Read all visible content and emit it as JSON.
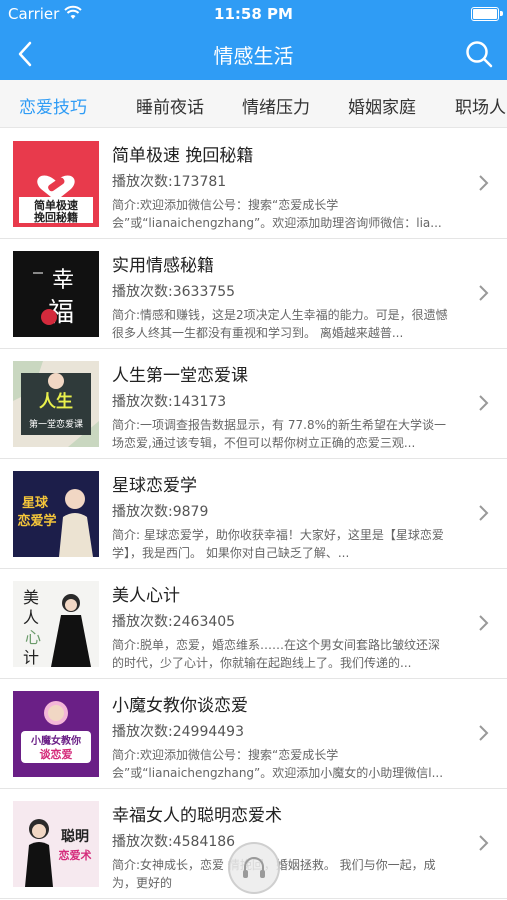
{
  "status_bar": {
    "carrier": "Carrier",
    "time": "11:58 PM"
  },
  "nav": {
    "title": "情感生活"
  },
  "tabs": [
    {
      "label": "恋爱技巧",
      "active": true
    },
    {
      "label": "睡前夜话",
      "active": false
    },
    {
      "label": "情绪压力",
      "active": false
    },
    {
      "label": "婚姻家庭",
      "active": false
    },
    {
      "label": "职场人",
      "active": false
    }
  ],
  "items": [
    {
      "title": "简单极速 挽回秘籍",
      "plays": "播放次数:173781",
      "desc": "简介:欢迎添加微信公号：搜索“恋爱成长学会”或“lianaichengzhang”。欢迎添加助理咨询师微信：lia...",
      "cover_text": "简单极速挽回秘籍"
    },
    {
      "title": "实用情感秘籍",
      "plays": "播放次数:3633755",
      "desc": "简介:情感和赚钱，这是2项决定人生幸福的能力。可是，很遗憾很多人终其一生都没有重视和学习到。 离婚越来越普...",
      "cover_text": "幸福"
    },
    {
      "title": "人生第一堂恋爱课",
      "plays": "播放次数:143173",
      "desc": "简介:一项调查报告数据显示，有 77.8%的新生希望在大学谈一场恋爱,通过该专辑，不但可以帮你树立正确的恋爱三观...",
      "cover_text": "人生第一堂恋爱课"
    },
    {
      "title": "星球恋爱学",
      "plays": "播放次数:9879",
      "desc": "简介:        星球恋爱学，助你收获幸福！大家好，这里是【星球恋爱学】，我是西门。         如果你对自己缺乏了解、...",
      "cover_text": "星球恋爱学"
    },
    {
      "title": "美人心计",
      "plays": "播放次数:2463405",
      "desc": "简介:脱单，恋爱，婚恋维系……在这个男女间套路比皱纹还深的时代，少了心计，你就输在起跑线上了。我们传递的...",
      "cover_text": "美人心计"
    },
    {
      "title": "小魔女教你谈恋爱",
      "plays": "播放次数:24994493",
      "desc": "简介:欢迎添加微信公号：搜索“恋爱成长学会”或“lianaichengzhang”。欢迎添加小魔女的小助理微信l...",
      "cover_text": "小魔女教你谈恋爱"
    },
    {
      "title": "幸福女人的聪明恋爱术",
      "plays": "播放次数:4584186",
      "desc": "简介:女神成长，恋爱        情挽回，婚姻拯救。 我们与你一起，成为，更好的",
      "cover_text": "聪明恋爱术"
    }
  ]
}
